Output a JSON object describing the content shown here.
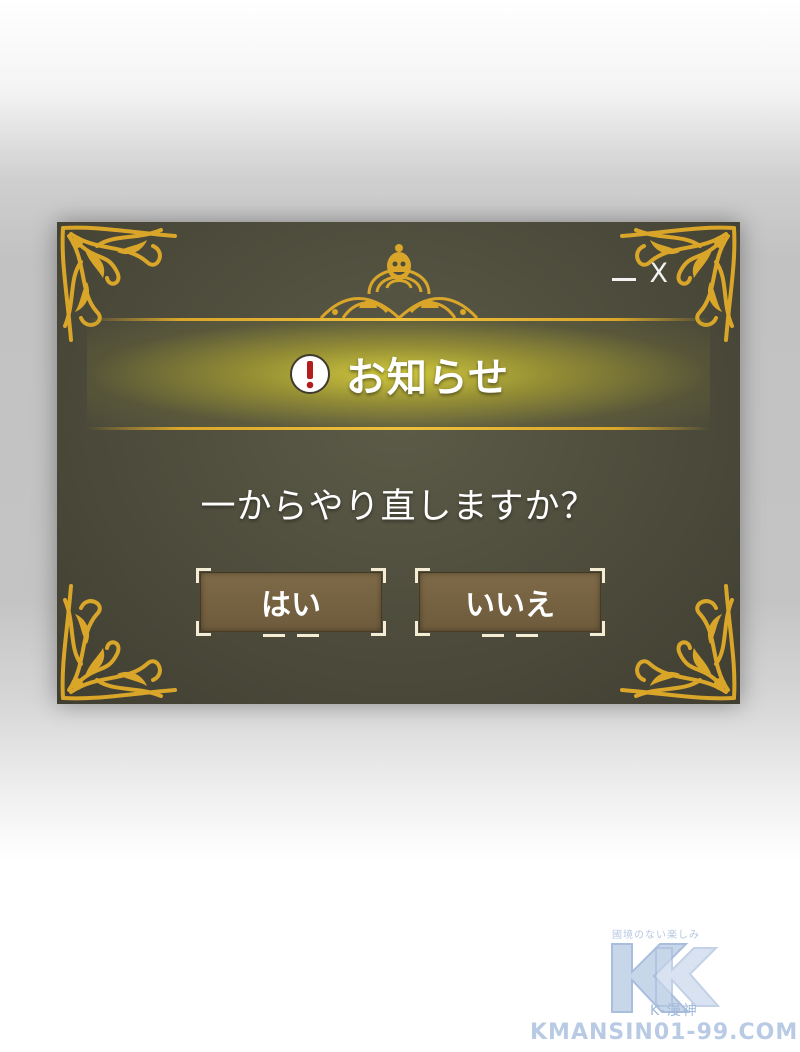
{
  "dialog": {
    "title": "お知らせ",
    "message": "一からやり直しますか？",
    "controls": {
      "minimize_icon": "minimize-icon",
      "close_label": "X"
    },
    "buttons": {
      "yes_label": "はい",
      "no_label": "いいえ"
    },
    "colors": {
      "panel": "#4d4c3c",
      "gold": "#d9a62a",
      "button": "#7e6a47",
      "alert_red": "#b21e1e"
    },
    "icons": {
      "alert": "exclamation-circle-icon",
      "ornament": "gold-filigree-ornament"
    }
  },
  "watermark": {
    "tagline": "國境のない楽しみ",
    "logo_letter": "K",
    "subtitle": "K-漫神",
    "url": "KMANSIN01-99.COM"
  }
}
